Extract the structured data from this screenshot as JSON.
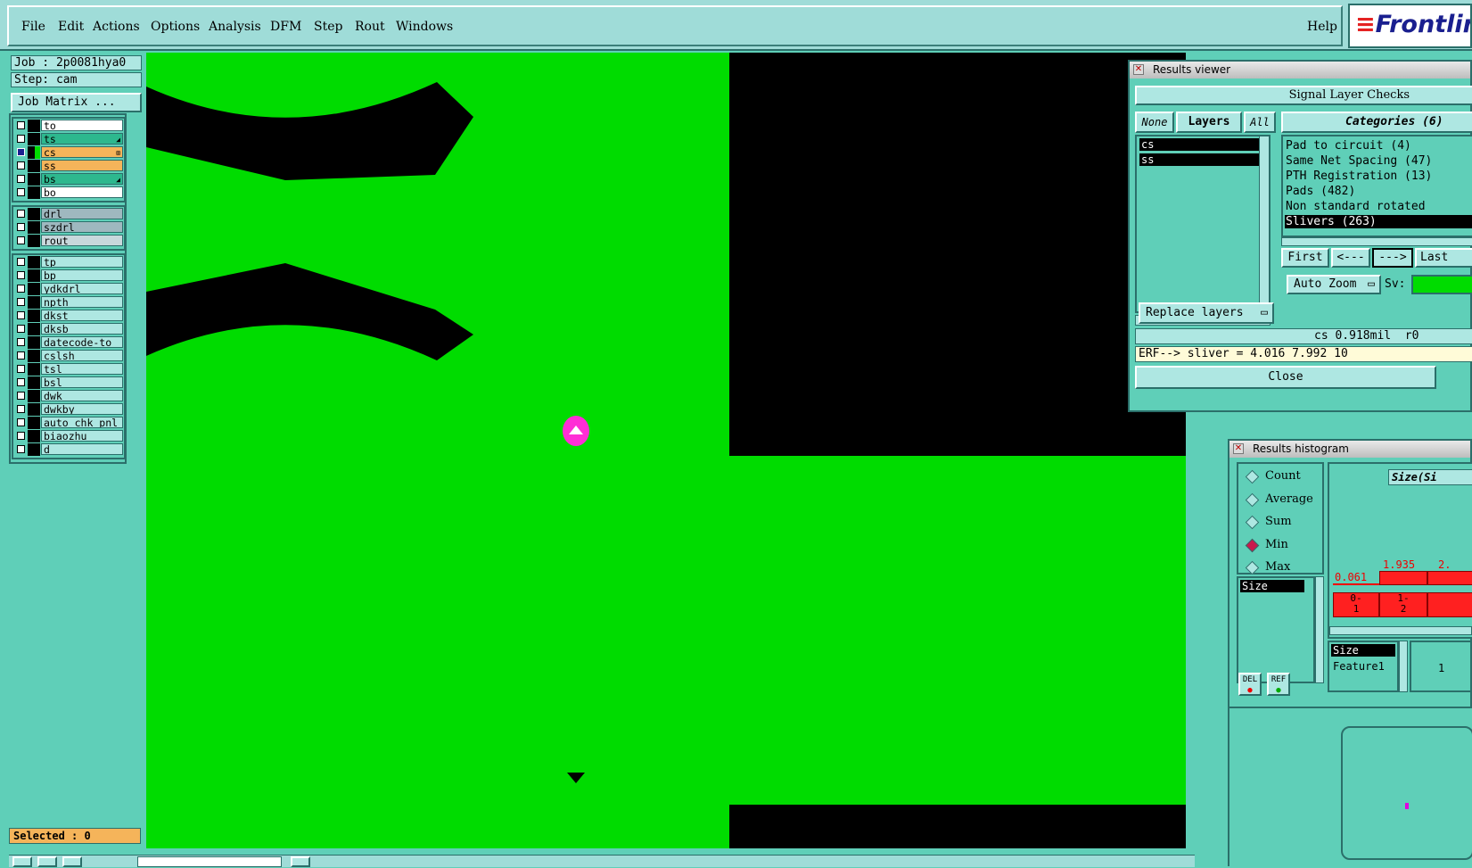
{
  "menubar": {
    "items": [
      "File",
      "Edit",
      "Actions",
      "Options",
      "Analysis",
      "DFM",
      "Step",
      "Rout",
      "Windows"
    ],
    "help": "Help",
    "logo": "Frontline"
  },
  "left_panel": {
    "job_label": "Job : 2p0081hya0",
    "step_label": "Step: cam",
    "job_matrix_button": "Job Matrix ...",
    "layer_groups": [
      [
        {
          "name": "to",
          "color": "#ffffff",
          "checked": false,
          "marker": ""
        },
        {
          "name": "ts",
          "color": "#2db88e",
          "checked": false,
          "marker": "◢"
        },
        {
          "name": "cs",
          "color": "#f5b45a",
          "checked": true,
          "marker": "⊞"
        },
        {
          "name": "ss",
          "color": "#f5b45a",
          "checked": false,
          "marker": ""
        },
        {
          "name": "bs",
          "color": "#2db88e",
          "checked": false,
          "marker": "◢"
        },
        {
          "name": "bo",
          "color": "#ffffff",
          "checked": false,
          "marker": ""
        }
      ],
      [
        {
          "name": "drl",
          "color": "#9fb8bf",
          "checked": false,
          "marker": ""
        },
        {
          "name": "szdrl",
          "color": "#9fb8bf",
          "checked": false,
          "marker": ""
        },
        {
          "name": "rout",
          "color": "#c8d8dc",
          "checked": false,
          "marker": ""
        }
      ],
      [
        {
          "name": "tp",
          "color": "#aee7e2",
          "checked": false,
          "marker": ""
        },
        {
          "name": "bp",
          "color": "#aee7e2",
          "checked": false,
          "marker": ""
        },
        {
          "name": "ydkdrl",
          "color": "#aee7e2",
          "checked": false,
          "marker": ""
        },
        {
          "name": "npth",
          "color": "#aee7e2",
          "checked": false,
          "marker": ""
        },
        {
          "name": "dkst",
          "color": "#aee7e2",
          "checked": false,
          "marker": ""
        },
        {
          "name": "dksb",
          "color": "#aee7e2",
          "checked": false,
          "marker": ""
        },
        {
          "name": "datecode-to",
          "color": "#aee7e2",
          "checked": false,
          "marker": ""
        },
        {
          "name": "cslsh",
          "color": "#aee7e2",
          "checked": false,
          "marker": ""
        },
        {
          "name": "tsl",
          "color": "#aee7e2",
          "checked": false,
          "marker": ""
        },
        {
          "name": "bsl",
          "color": "#aee7e2",
          "checked": false,
          "marker": ""
        },
        {
          "name": "dwk",
          "color": "#aee7e2",
          "checked": false,
          "marker": ""
        },
        {
          "name": "dwkby",
          "color": "#aee7e2",
          "checked": false,
          "marker": ""
        },
        {
          "name": "auto_chk_pnl",
          "color": "#aee7e2",
          "checked": false,
          "marker": ""
        },
        {
          "name": "biaozhu",
          "color": "#aee7e2",
          "checked": false,
          "marker": ""
        },
        {
          "name": "d",
          "color": "#aee7e2",
          "checked": false,
          "marker": ""
        }
      ]
    ],
    "selected_label": "Selected : 0"
  },
  "results_viewer": {
    "title": "Results viewer",
    "header": "Signal Layer Checks",
    "none_button": "None",
    "layers_label": "Layers",
    "all_button": "All",
    "categories_label": "Categories (6)",
    "layers": [
      "cs",
      "ss"
    ],
    "categories": [
      "Pad to circuit (4)",
      "Same Net Spacing (47)",
      "PTH Registration (13)",
      "Pads (482)",
      "Non standard rotated",
      "Slivers (263)"
    ],
    "selected_category": "Slivers (263)",
    "nav": {
      "first": "First",
      "prev": "<---",
      "next": "--->",
      "last": "Last"
    },
    "auto_zoom": "Auto Zoom",
    "sv_label": "Sv:",
    "replace_layers": "Replace layers",
    "status": "cs 0.918mil  r0",
    "erf_text": "ERF--> sliver = 4.016 7.992 10",
    "close": "Close"
  },
  "histogram": {
    "title": "Results histogram",
    "modes": [
      "Count",
      "Average",
      "Sum",
      "Min",
      "Max"
    ],
    "selected_mode": "Min",
    "size_item": "Size",
    "header_field": "Size(Si",
    "bar_values": [
      "0.061",
      "1.935",
      "2."
    ],
    "bin_labels": [
      "0-\n1",
      "1-\n2"
    ],
    "del_label": "DEL",
    "ref_label": "REF",
    "list_items": [
      "Size",
      "Feature1"
    ],
    "list_value": "1"
  },
  "colors": {
    "board_green": "#00dc00",
    "panel_teal": "#5fcfb8",
    "menubar": "#9fdcd8",
    "highlight_red": "#ff2020"
  }
}
